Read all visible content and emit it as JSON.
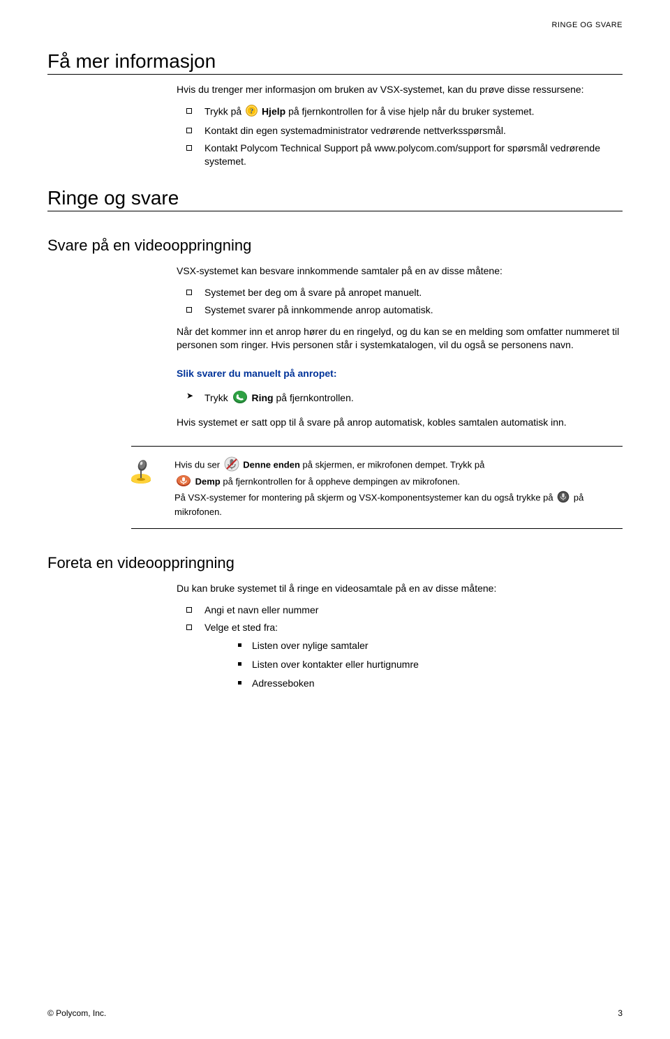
{
  "running_head": "RINGE OG SVARE",
  "h1a": "Få mer informasjon",
  "intro_a": "Hvis du trenger mer informasjon om bruken av VSX-systemet, kan du prøve disse ressursene:",
  "list_a": {
    "i1_pre": "Trykk på ",
    "i1_bold": "Hjelp",
    "i1_post": " på fjernkontrollen for å vise hjelp når du bruker systemet.",
    "i2": "Kontakt din egen systemadministrator vedrørende nettverksspørsmål.",
    "i3": "Kontakt Polycom Technical Support på www.polycom.com/support for spørsmål vedrørende systemet."
  },
  "h1b": "Ringe og svare",
  "h2a": "Svare på en videooppringning",
  "para_b": "VSX-systemet kan besvare innkommende samtaler på en av disse måtene:",
  "list_b": {
    "i1": "Systemet ber deg om å svare på anropet manuelt.",
    "i2": "Systemet svarer på innkommende anrop automatisk."
  },
  "para_c": "Når det kommer inn et anrop hører du en ringelyd, og du kan se en melding som omfatter nummeret til personen som ringer. Hvis personen står i systemkatalogen, vil du også se personens navn.",
  "blue1": "Slik svarer du manuelt på anropet:",
  "arrow1_pre": "Trykk ",
  "arrow1_bold": "Ring",
  "arrow1_post": " på fjernkontrollen.",
  "para_d": "Hvis systemet er satt opp til å svare på anrop automatisk, kobles samtalen automatisk inn.",
  "note": {
    "l1_pre": "Hvis du ser ",
    "l1_bold": "Denne enden",
    "l1_post": " på skjermen, er mikrofonen dempet. Trykk på",
    "l2_bold": "Demp",
    "l2_post": " på fjernkontrollen for å oppheve dempingen av mikrofonen.",
    "l3": "På VSX-systemer for montering på skjerm og VSX-komponentsystemer kan du også trykke på ",
    "l4": " på mikrofonen."
  },
  "h2b": "Foreta en videooppringning",
  "para_e": "Du kan bruke systemet til å ringe en videosamtale på en av disse måtene:",
  "list_e": {
    "i1": "Angi et navn eller nummer",
    "i2": "Velge et sted fra:",
    "sub": {
      "s1": "Listen over nylige samtaler",
      "s2": "Listen over kontakter eller hurtignumre",
      "s3": "Adresseboken"
    }
  },
  "footer": {
    "left": "© Polycom, Inc.",
    "right": "3"
  }
}
